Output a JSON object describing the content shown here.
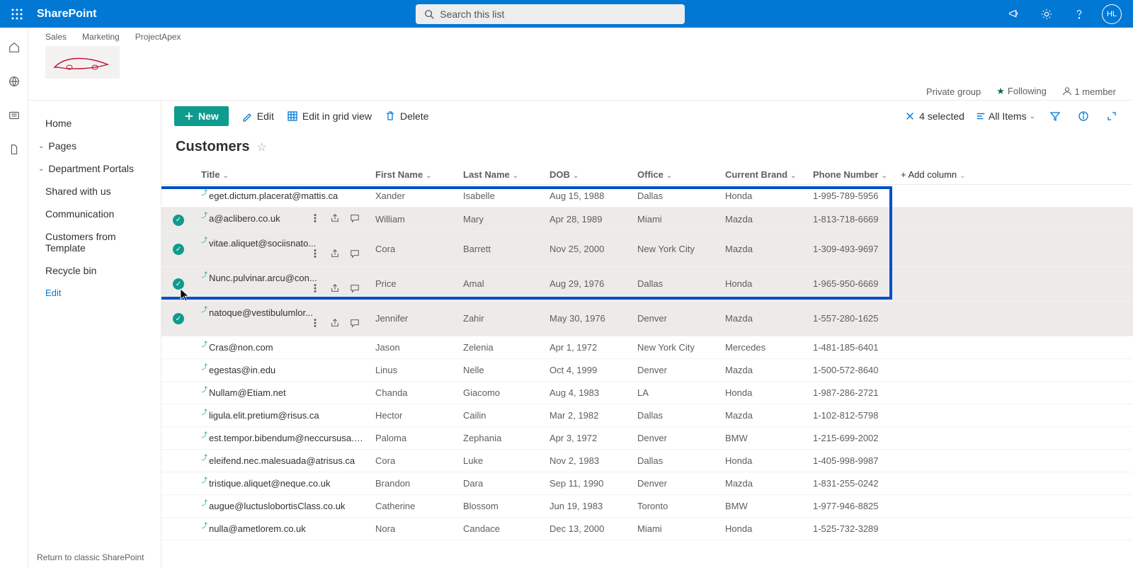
{
  "suite": {
    "brand": "SharePoint",
    "search_placeholder": "Search this list",
    "avatar_initials": "HL"
  },
  "site": {
    "tabs": [
      "Sales",
      "Marketing",
      "ProjectApex"
    ],
    "privacy": "Private group",
    "following_label": "Following",
    "members_label": "1 member"
  },
  "nav": {
    "home": "Home",
    "pages": "Pages",
    "dept": "Department Portals",
    "shared": "Shared with us",
    "comm": "Communication",
    "custfromtpl": "Customers from Template",
    "recycle": "Recycle bin",
    "edit": "Edit",
    "return_classic": "Return to classic SharePoint"
  },
  "cmd": {
    "new_label": "New",
    "edit": "Edit",
    "edit_grid": "Edit in grid view",
    "delete": "Delete",
    "selected_count": "4 selected",
    "view_name": "All Items"
  },
  "list": {
    "title": "Customers"
  },
  "columns": {
    "title": "Title",
    "first_name": "First Name",
    "last_name": "Last Name",
    "dob": "DOB",
    "office": "Office",
    "brand": "Current Brand",
    "phone": "Phone Number",
    "add": "Add column"
  },
  "rows": [
    {
      "sel": false,
      "title": "eget.dictum.placerat@mattis.ca",
      "fn": "Xander",
      "ln": "Isabelle",
      "dob": "Aug 15, 1988",
      "office": "Dallas",
      "brand": "Honda",
      "phone": "1-995-789-5956"
    },
    {
      "sel": true,
      "title": "a@aclibero.co.uk",
      "fn": "William",
      "ln": "Mary",
      "dob": "Apr 28, 1989",
      "office": "Miami",
      "brand": "Mazda",
      "phone": "1-813-718-6669"
    },
    {
      "sel": true,
      "title": "vitae.aliquet@sociisnato...",
      "fn": "Cora",
      "ln": "Barrett",
      "dob": "Nov 25, 2000",
      "office": "New York City",
      "brand": "Mazda",
      "phone": "1-309-493-9697"
    },
    {
      "sel": true,
      "title": "Nunc.pulvinar.arcu@con...",
      "fn": "Price",
      "ln": "Amal",
      "dob": "Aug 29, 1976",
      "office": "Dallas",
      "brand": "Honda",
      "phone": "1-965-950-6669"
    },
    {
      "sel": true,
      "title": "natoque@vestibulumlor...",
      "fn": "Jennifer",
      "ln": "Zahir",
      "dob": "May 30, 1976",
      "office": "Denver",
      "brand": "Mazda",
      "phone": "1-557-280-1625"
    },
    {
      "sel": false,
      "title": "Cras@non.com",
      "fn": "Jason",
      "ln": "Zelenia",
      "dob": "Apr 1, 1972",
      "office": "New York City",
      "brand": "Mercedes",
      "phone": "1-481-185-6401"
    },
    {
      "sel": false,
      "title": "egestas@in.edu",
      "fn": "Linus",
      "ln": "Nelle",
      "dob": "Oct 4, 1999",
      "office": "Denver",
      "brand": "Mazda",
      "phone": "1-500-572-8640"
    },
    {
      "sel": false,
      "title": "Nullam@Etiam.net",
      "fn": "Chanda",
      "ln": "Giacomo",
      "dob": "Aug 4, 1983",
      "office": "LA",
      "brand": "Honda",
      "phone": "1-987-286-2721"
    },
    {
      "sel": false,
      "title": "ligula.elit.pretium@risus.ca",
      "fn": "Hector",
      "ln": "Cailin",
      "dob": "Mar 2, 1982",
      "office": "Dallas",
      "brand": "Mazda",
      "phone": "1-102-812-5798"
    },
    {
      "sel": false,
      "title": "est.tempor.bibendum@neccursusa.com",
      "fn": "Paloma",
      "ln": "Zephania",
      "dob": "Apr 3, 1972",
      "office": "Denver",
      "brand": "BMW",
      "phone": "1-215-699-2002"
    },
    {
      "sel": false,
      "title": "eleifend.nec.malesuada@atrisus.ca",
      "fn": "Cora",
      "ln": "Luke",
      "dob": "Nov 2, 1983",
      "office": "Dallas",
      "brand": "Honda",
      "phone": "1-405-998-9987"
    },
    {
      "sel": false,
      "title": "tristique.aliquet@neque.co.uk",
      "fn": "Brandon",
      "ln": "Dara",
      "dob": "Sep 11, 1990",
      "office": "Denver",
      "brand": "Mazda",
      "phone": "1-831-255-0242"
    },
    {
      "sel": false,
      "title": "augue@luctuslobortisClass.co.uk",
      "fn": "Catherine",
      "ln": "Blossom",
      "dob": "Jun 19, 1983",
      "office": "Toronto",
      "brand": "BMW",
      "phone": "1-977-946-8825"
    },
    {
      "sel": false,
      "title": "nulla@ametlorem.co.uk",
      "fn": "Nora",
      "ln": "Candace",
      "dob": "Dec 13, 2000",
      "office": "Miami",
      "brand": "Honda",
      "phone": "1-525-732-3289"
    }
  ]
}
